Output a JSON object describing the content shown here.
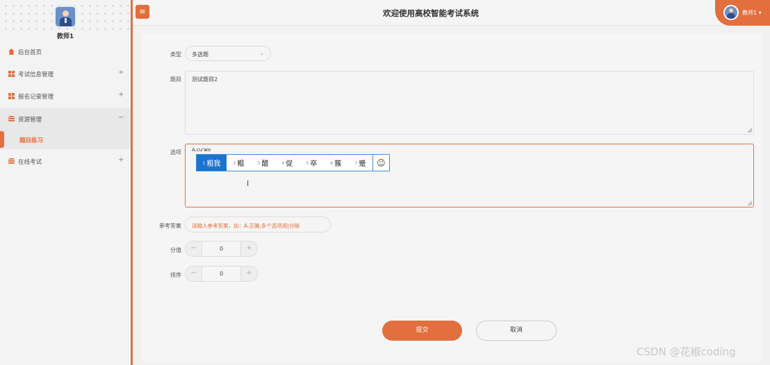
{
  "sidebar": {
    "username": "教师1",
    "items": [
      {
        "label": "后台首页",
        "toggle": "",
        "icon": "home-icon"
      },
      {
        "label": "考试信息管理",
        "toggle": "+",
        "icon": "grid-icon"
      },
      {
        "label": "报名记录管理",
        "toggle": "+",
        "icon": "grid-icon"
      },
      {
        "label": "资源管理",
        "toggle": "−",
        "icon": "database-icon"
      },
      {
        "label": "在线考试",
        "toggle": "+",
        "icon": "database-icon"
      }
    ],
    "submenu": {
      "label": "题目练习"
    }
  },
  "header": {
    "menu_icon": "≡",
    "title": "欢迎使用高校智能考试系统",
    "user": "教师1 ▾"
  },
  "form": {
    "type_label": "类型",
    "type_value": "多选题",
    "question_label": "题目",
    "question_value": "测试题目2",
    "options_label": "选项",
    "ime": {
      "pinyin": "A.cu'wo",
      "candidates": [
        {
          "n": "1",
          "t": "粗我"
        },
        {
          "n": "2",
          "t": "粗"
        },
        {
          "n": "3",
          "t": "醋"
        },
        {
          "n": "4",
          "t": "促"
        },
        {
          "n": "5",
          "t": "卒"
        },
        {
          "n": "6",
          "t": "簇"
        },
        {
          "n": "7",
          "t": "蹙"
        }
      ],
      "emoji": "☺"
    },
    "answer_label": "参考答案",
    "answer_placeholder": "请输入参考答案，如：A.正确,多个选项用|分隔",
    "score_label": "分值",
    "score_value": "0",
    "order_label": "排序",
    "order_value": "0",
    "minus": "−",
    "plus": "+",
    "submit": "提交",
    "cancel": "取消"
  },
  "watermark": "CSDN @花椒coding",
  "colors": {
    "accent": "#e26f3e",
    "ime_blue": "#1a74d0"
  }
}
